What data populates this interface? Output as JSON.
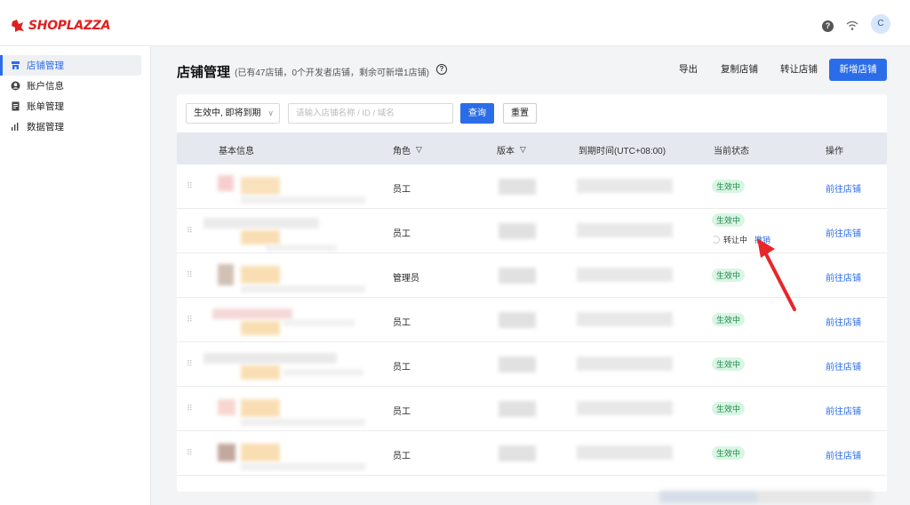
{
  "brand": {
    "name": "SHOPLAZZA",
    "color": "#e02020"
  },
  "topbar": {
    "avatar_letter": "C",
    "icons": [
      "help-icon",
      "wifi-icon"
    ]
  },
  "sidebar": {
    "items": [
      {
        "label": "店铺管理",
        "icon": "store-icon",
        "active": true
      },
      {
        "label": "账户信息",
        "icon": "user-circle-icon",
        "active": false
      },
      {
        "label": "账单管理",
        "icon": "bill-icon",
        "active": false
      },
      {
        "label": "数据管理",
        "icon": "bar-chart-icon",
        "active": false
      }
    ]
  },
  "header": {
    "title": "店铺管理",
    "subtitle": "(已有47店铺，0个开发者店铺，剩余可新增1店铺)",
    "export_label": "导出",
    "copy_label": "复制店铺",
    "transfer_label": "转让店铺",
    "new_label": "新增店铺"
  },
  "filters": {
    "status_value": "生效中, 即将到期",
    "search_placeholder": "请输入店铺名称 / ID / 域名",
    "query_label": "查询",
    "reset_label": "重置"
  },
  "table": {
    "columns": [
      "基本信息",
      "角色",
      "版本",
      "到期时间(UTC+08:00)",
      "当前状态",
      "操作"
    ],
    "rows": [
      {
        "role": "员工",
        "status": "生效中",
        "action": "前往店铺"
      },
      {
        "role": "员工",
        "status": "生效中",
        "transfer_text": "转让中",
        "revoke_label": "撤销",
        "action": "前往店铺"
      },
      {
        "role": "管理员",
        "status": "生效中",
        "action": "前往店铺"
      },
      {
        "role": "员工",
        "status": "生效中",
        "action": "前往店铺"
      },
      {
        "role": "员工",
        "status": "生效中",
        "action": "前往店铺"
      },
      {
        "role": "员工",
        "status": "生效中",
        "action": "前往店铺"
      },
      {
        "role": "员工",
        "status": "生效中",
        "action": "前往店铺"
      }
    ]
  },
  "colors": {
    "primary": "#2b6de8",
    "success_bg": "#d9f5e3",
    "success_text": "#1e8a4b",
    "annotation_arrow": "#e8262a"
  }
}
